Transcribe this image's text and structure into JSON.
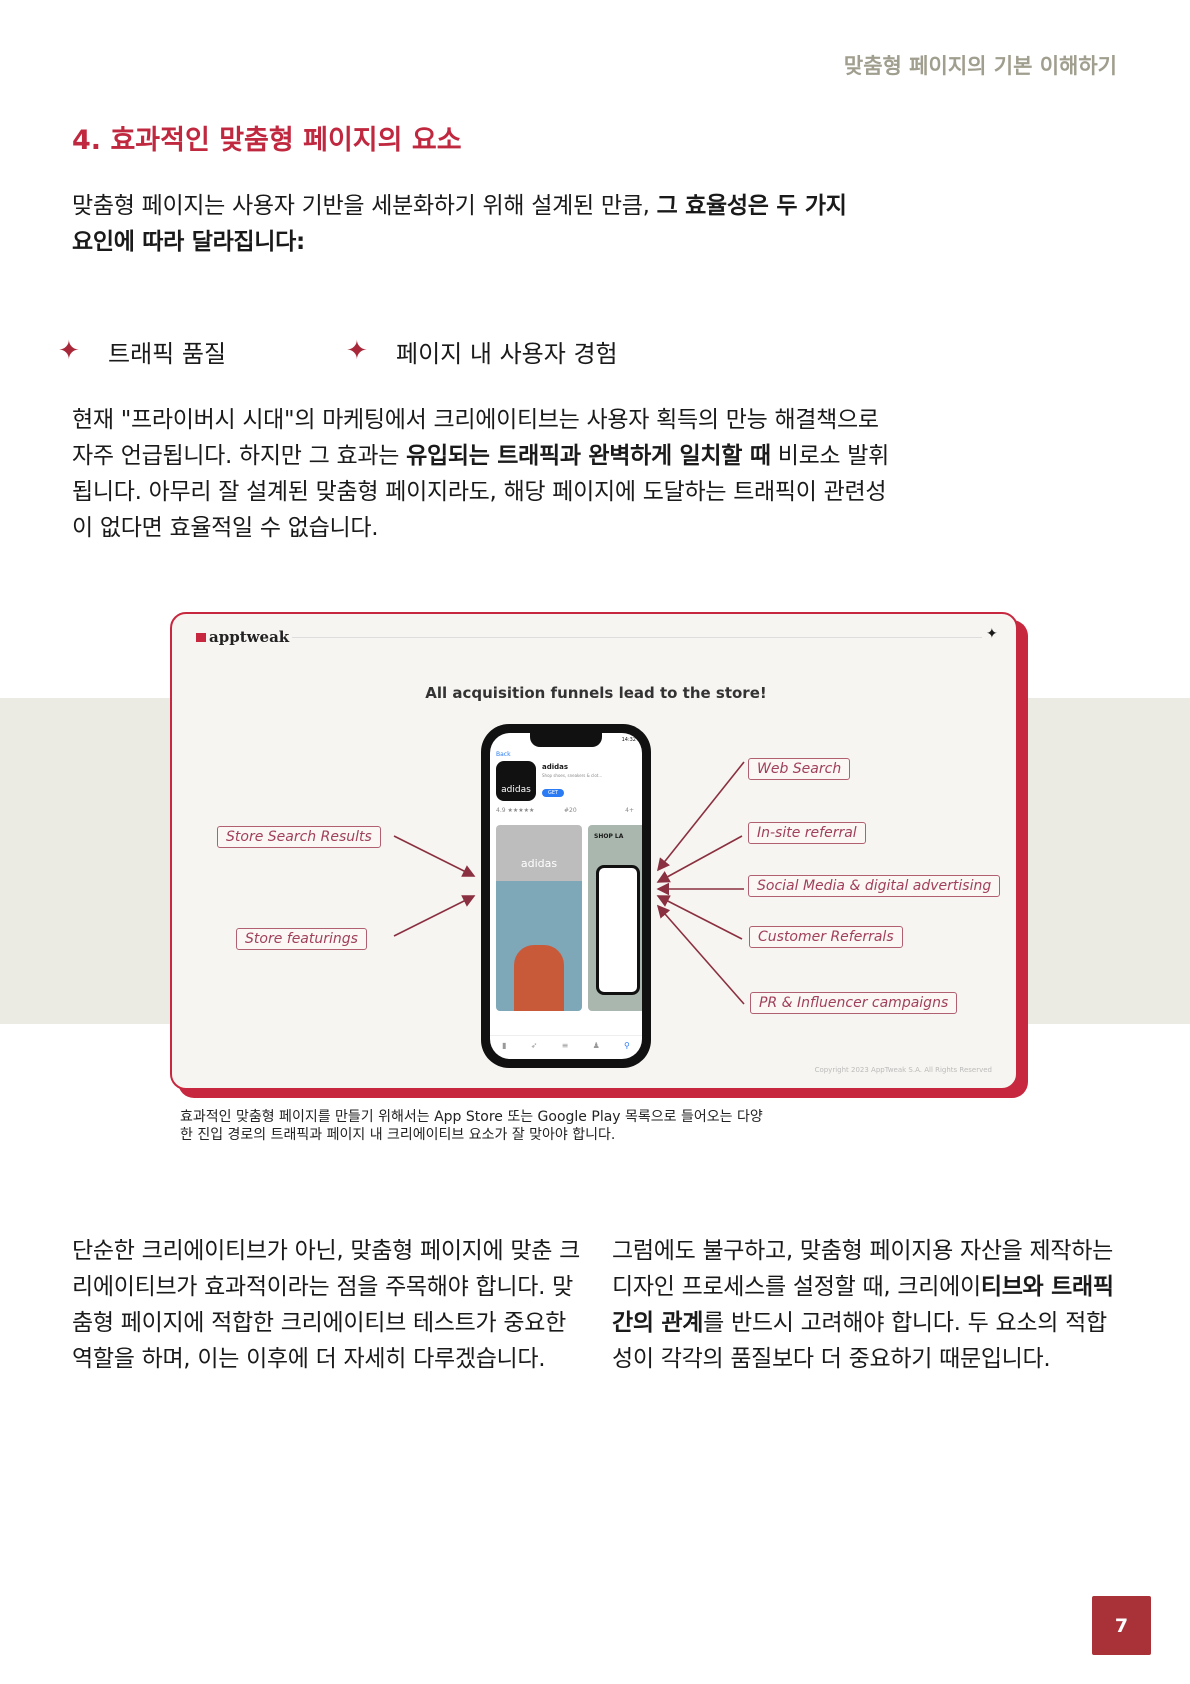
{
  "header": {
    "running_title": "맞춤형 페이지의 기본 이해하기"
  },
  "section": {
    "title": "4. 효과적인 맞춤형 페이지의 요소"
  },
  "intro": {
    "text": "맞춤형 페이지는 사용자 기반을 세분화하기 위해 설계된 만큼, ",
    "bold": "그 효율성은 두 가지 요인에 따라 달라집니다:"
  },
  "bullets": [
    {
      "icon": "sparkle-star-icon",
      "label": "트래픽 품질"
    },
    {
      "icon": "sparkle-star-icon",
      "label": "페이지 내 사용자 경험"
    }
  ],
  "para2": {
    "a": "현재 \"프라이버시 시대\"의 마케팅에서 크리에이티브는 사용자 획득의 만능 해결책으로 자주 언급됩니다. 하지만 그 효과는 ",
    "bold": "유입되는 트래픽과 완벽하게 일치할 때",
    "b": " 비로소 발휘됩니다. 아무리 잘 설계된 맞춤형 페이지라도, 해당 페이지에 도달하는 트래픽이 관련성이 없다면 효율적일 수 없습니다."
  },
  "figure": {
    "logo": "apptweak",
    "title": "All acquisition funnels lead to the store!",
    "left_labels": [
      "Store Search Results",
      "Store featurings"
    ],
    "right_labels": [
      "Web Search",
      "In-site referral",
      "Social Media & digital advertising",
      "Customer Referrals",
      "PR & Influencer campaigns"
    ],
    "phone": {
      "app_name": "adidas",
      "subtitle": "Shop shoes, sneakers & clot...",
      "get": "GET",
      "rating": "4.9 ★★★★★",
      "rank": "#20",
      "age": "4+",
      "back": "Back",
      "time": "14:32",
      "brand": "adidas",
      "promo": "SHOP LA"
    },
    "copyright": "Copyright 2023 AppTweak S.A. All Rights Reserved",
    "colors": {
      "accent": "#c8283f",
      "arrow": "#8a3040"
    }
  },
  "caption": {
    "line1": "효과적인 맞춤형 페이지를 만들기 위해서는 App Store 또는 Google Play 목록으로 들어오는 다양",
    "line2": "한 진입 경로의 트래픽과 페이지 내 크리에이티브 요소가 잘 맞아야 합니다."
  },
  "col_left": {
    "text": "단순한 크리에이티브가 아닌, 맞춤형 페이지에 맞춘 크리에이티브가 효과적이라는 점을 주목해야 합니다. 맞춤형 페이지에 적합한 크리에이티브 테스트가 중요한 역할을 하며, 이는 이후에 더 자세히 다루겠습니다."
  },
  "col_right": {
    "a": "그럼에도 불구하고, 맞춤형 페이지용 자산을 제작하는 디자인 프로세스를 설정할 때, 크리에이",
    "bold": "티브와 트래픽 간의 관계",
    "b": "를 반드시 고려해야 합니다. 두 요소의 적합성이 각각의 품질보다 더 중요하기 때문입니다."
  },
  "page_number": "7",
  "colors": {
    "heading": "#c0283f",
    "page_badge": "#a83238",
    "running_title": "#a09e8e"
  }
}
